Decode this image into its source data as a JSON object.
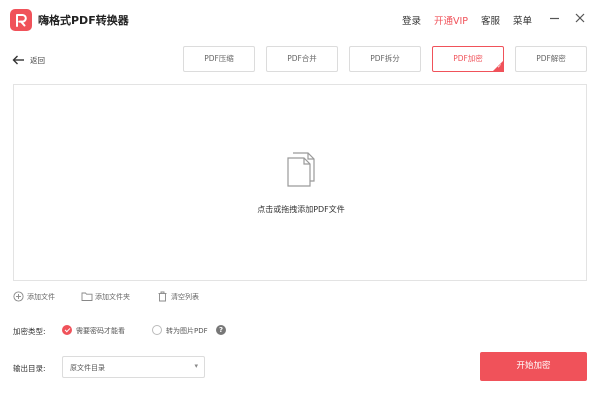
{
  "app": {
    "title": "嗨格式PDF转换器",
    "accent_color": "#f0525a"
  },
  "topbar": {
    "login": "登录",
    "vip": "开通VIP",
    "service": "客服",
    "menu": "菜单",
    "icons": [
      "minimize-icon",
      "close-icon"
    ]
  },
  "nav": {
    "back_label": "返回"
  },
  "tabs": [
    {
      "label": "PDF压缩",
      "active": false
    },
    {
      "label": "PDF合并",
      "active": false
    },
    {
      "label": "PDF拆分",
      "active": false
    },
    {
      "label": "PDF加密",
      "active": true
    },
    {
      "label": "PDF解密",
      "active": false
    }
  ],
  "dropzone": {
    "text": "点击或拖拽添加PDF文件",
    "icon": "document-stack-icon"
  },
  "actions": {
    "add_file": "添加文件",
    "add_folder": "添加文件夹",
    "clear_list": "清空列表"
  },
  "encrypt": {
    "label": "加密类型:",
    "options": [
      {
        "label": "需要密码才能看",
        "selected": true
      },
      {
        "label": "转为图片PDF",
        "selected": false
      }
    ]
  },
  "output": {
    "label": "输出目录:",
    "value": "原文件目录"
  },
  "start_button": "开始加密"
}
